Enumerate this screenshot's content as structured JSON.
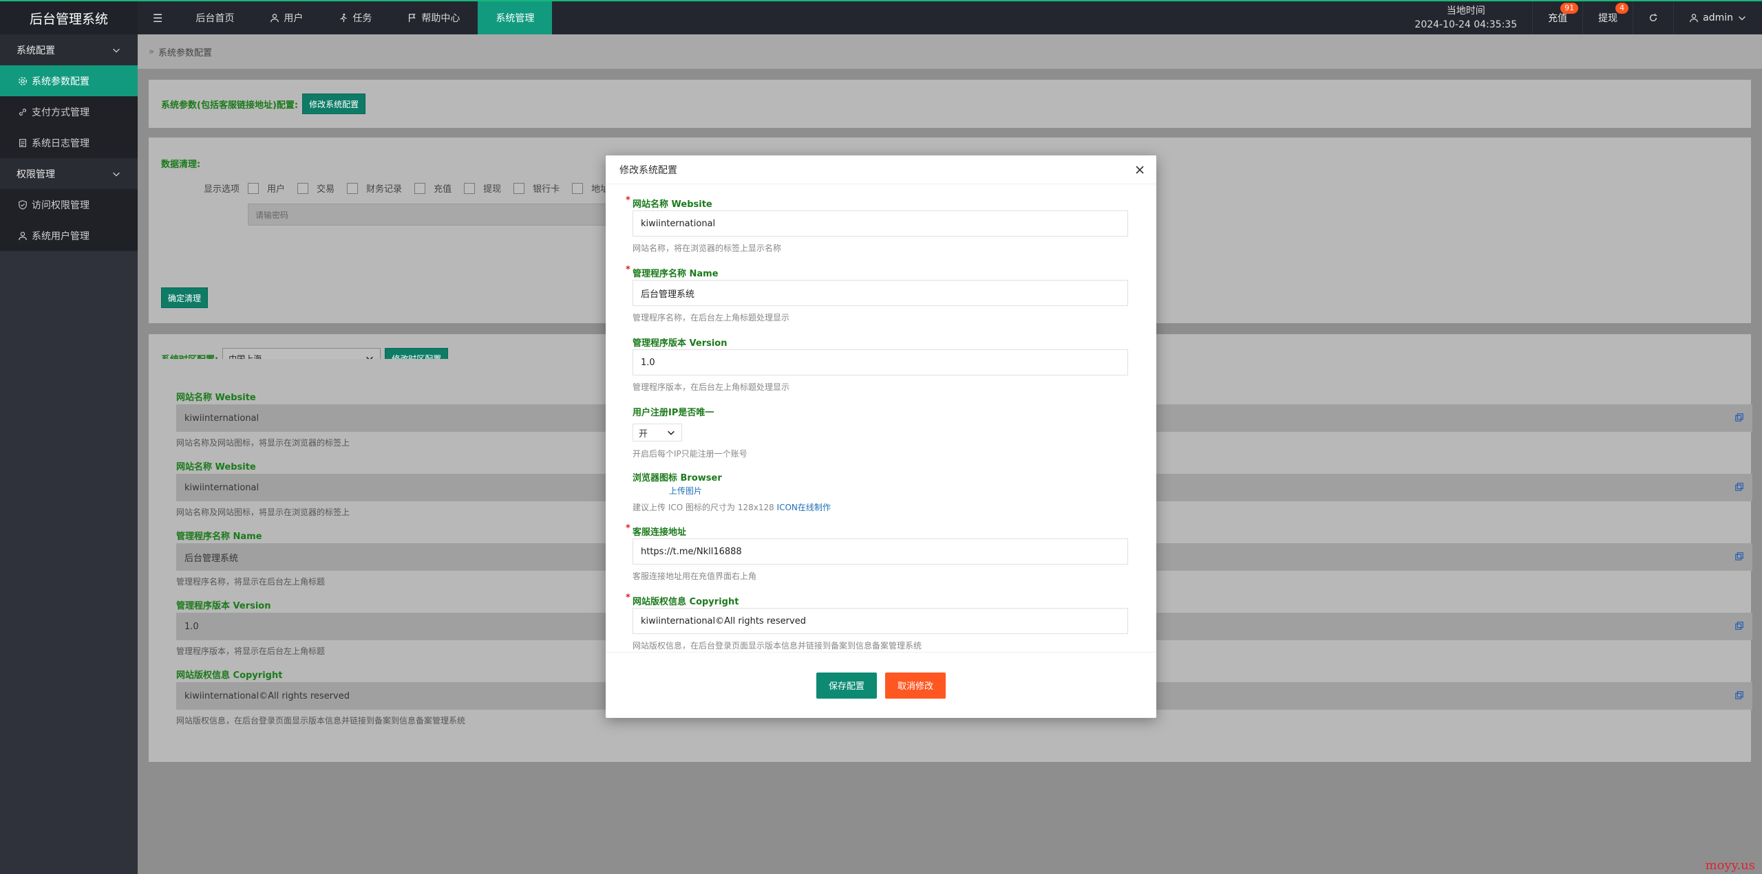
{
  "app": {
    "title": "后台管理系统"
  },
  "topnav": {
    "items": [
      {
        "label": "后台首页"
      },
      {
        "label": "用户"
      },
      {
        "label": "任务"
      },
      {
        "label": "帮助中心"
      },
      {
        "label": "系统管理"
      }
    ],
    "time_label": "当地时间",
    "time_value": "2024-10-24 04:35:35",
    "recharge_label": "充值",
    "recharge_badge": "91",
    "withdraw_label": "提现",
    "withdraw_badge": "4",
    "user_label": "admin"
  },
  "sidebar": {
    "groups": [
      {
        "label": "系统配置"
      },
      {
        "label": "权限管理"
      }
    ],
    "items": [
      {
        "label": "系统参数配置"
      },
      {
        "label": "支付方式管理"
      },
      {
        "label": "系统日志管理"
      },
      {
        "label": "访问权限管理"
      },
      {
        "label": "系统用户管理"
      }
    ]
  },
  "breadcrumb": {
    "text": "系统参数配置"
  },
  "panel1": {
    "label": "系统参数(包括客服链接地址)配置:",
    "button": "修改系统配置"
  },
  "panel2": {
    "label": "数据清理:",
    "options_label": "显示选项",
    "options": [
      "用户",
      "交易",
      "财务记录",
      "充值",
      "提现",
      "银行卡",
      "地址"
    ],
    "password_placeholder": "请输密码",
    "confirm_button": "确定清理"
  },
  "panel3": {
    "label": "系统时区配置:",
    "timezone": "中国上海",
    "button": "修改时区配置"
  },
  "panel4": {
    "fields": [
      {
        "label": "网站名称 Website",
        "value": "kiwiinternational",
        "hint": "网站名称及网站图标，将显示在浏览器的标签上"
      },
      {
        "label": "网站名称 Website",
        "value": "kiwiinternational",
        "hint": "网站名称及网站图标，将显示在浏览器的标签上"
      },
      {
        "label": "管理程序名称 Name",
        "value": "后台管理系统",
        "hint": "管理程序名称，将显示在后台左上角标题"
      },
      {
        "label": "管理程序版本 Version",
        "value": "1.0",
        "hint": "管理程序版本，将显示在后台左上角标题"
      },
      {
        "label": "网站版权信息 Copyright",
        "value": "kiwiinternational©All rights reserved",
        "hint": "网站版权信息，在后台登录页面显示版本信息并链接到备案到信息备案管理系统"
      }
    ]
  },
  "modal": {
    "title": "修改系统配置",
    "website_label": "网站名称 Website",
    "website_value": "kiwiinternational",
    "website_hint": "网站名称，将在浏览器的标签上显示名称",
    "name_label": "管理程序名称 Name",
    "name_value": "后台管理系统",
    "name_hint": "管理程序名称，在后台左上角标题处理显示",
    "version_label": "管理程序版本 Version",
    "version_value": "1.0",
    "version_hint": "管理程序版本，在后台左上角标题处理显示",
    "ip_label": "用户注册IP是否唯一",
    "ip_value": "开",
    "ip_hint": "开启后每个IP只能注册一个账号",
    "browser_label": "浏览器图标 Browser",
    "upload_label": "上传图片",
    "browser_hint": "建议上传 ICO 图标的尺寸为 128x128",
    "browser_hint_link": "ICON在线制作",
    "service_label": "客服连接地址",
    "service_value": "https://t.me/Nkll16888",
    "service_hint": "客服连接地址用在充值界面右上角",
    "copyright_label": "网站版权信息 Copyright",
    "copyright_value": "kiwiinternational©All rights reserved",
    "copyright_hint": "网站版权信息，在后台登录页面显示版本信息并链接到备案到信息备案管理系统",
    "save_button": "保存配置",
    "cancel_button": "取消修改"
  },
  "watermark": "moyy.us"
}
